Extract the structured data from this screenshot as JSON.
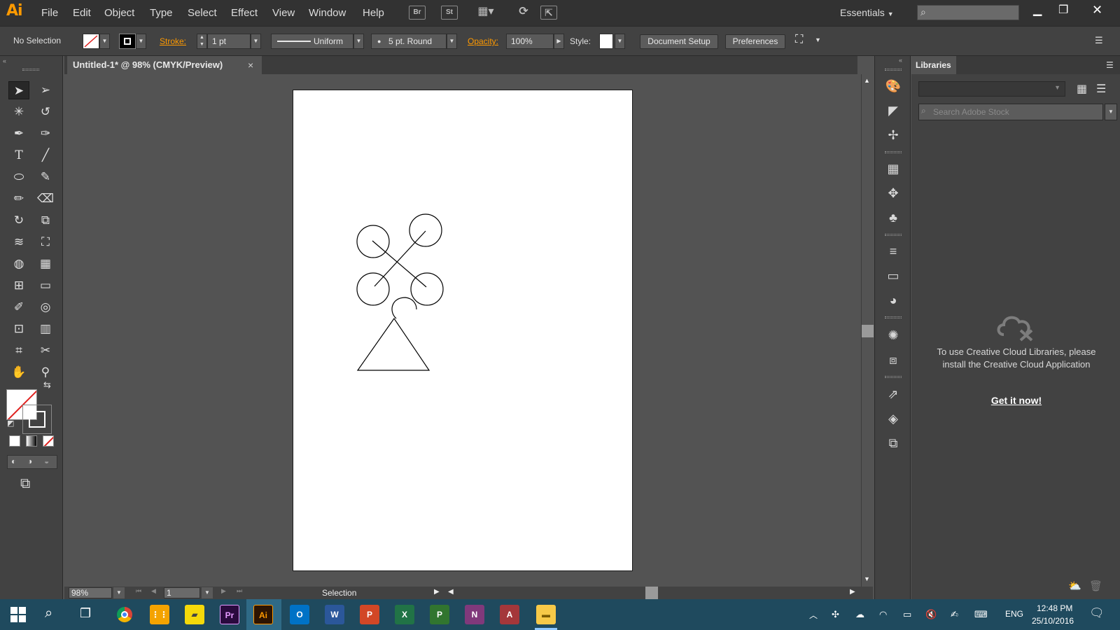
{
  "app": {
    "logo": "Ai",
    "menus": [
      "File",
      "Edit",
      "Object",
      "Type",
      "Select",
      "Effect",
      "View",
      "Window",
      "Help"
    ],
    "bridge_label": "Br",
    "stock_label": "St",
    "workspace": "Essentials"
  },
  "control": {
    "selection_label": "No Selection",
    "stroke_label": "Stroke:",
    "stroke_weight": "1 pt",
    "stroke_profile": "Uniform",
    "brush": "5 pt. Round",
    "opacity_label": "Opacity:",
    "opacity_value": "100%",
    "style_label": "Style:",
    "document_setup": "Document Setup",
    "preferences": "Preferences"
  },
  "document": {
    "tab_title": "Untitled-1* @ 98% (CMYK/Preview)",
    "close": "×"
  },
  "status": {
    "zoom": "98%",
    "page": "1",
    "tool": "Selection"
  },
  "libraries": {
    "title": "Libraries",
    "search_placeholder": "Search Adobe Stock",
    "message": "To use Creative Cloud Libraries, please install the Creative Cloud Application",
    "cta": "Get it now!"
  },
  "taskbar": {
    "apps": [
      {
        "name": "Chrome",
        "label": "",
        "color": "#dd4b39"
      },
      {
        "name": "Apps",
        "label": "",
        "color": "#f4a300"
      },
      {
        "name": "Sticky Notes",
        "label": "",
        "color": "#f5d90a"
      },
      {
        "name": "Premiere",
        "label": "Pr",
        "color": "#2a0a3e"
      },
      {
        "name": "Illustrator",
        "label": "Ai",
        "color": "#2d1400"
      },
      {
        "name": "Outlook",
        "label": "O",
        "color": "#0072c6"
      },
      {
        "name": "Word",
        "label": "W",
        "color": "#2b579a"
      },
      {
        "name": "PowerPoint",
        "label": "P",
        "color": "#d24726"
      },
      {
        "name": "Excel",
        "label": "X",
        "color": "#217346"
      },
      {
        "name": "Project",
        "label": "P",
        "color": "#31752f"
      },
      {
        "name": "OneNote",
        "label": "N",
        "color": "#80397b"
      },
      {
        "name": "Access",
        "label": "A",
        "color": "#a4373a"
      },
      {
        "name": "File Explorer",
        "label": "",
        "color": "#f7c948"
      }
    ],
    "language": "ENG",
    "time": "12:48 PM",
    "date": "25/10/2016"
  }
}
